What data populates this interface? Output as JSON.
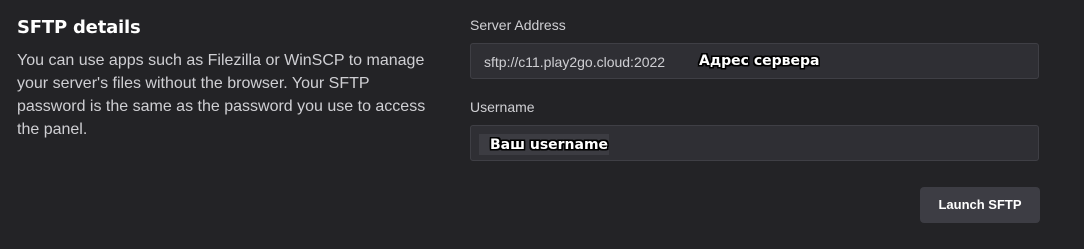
{
  "panel": {
    "title": "SFTP details",
    "description": "You can use apps such as Filezilla or WinSCP to manage your server's files without the browser. Your SFTP password is the same as the password you use to access the panel."
  },
  "server_address": {
    "label": "Server Address",
    "value": "sftp://c11.play2go.cloud:2022",
    "annotation": "Адрес сервера"
  },
  "username": {
    "label": "Username",
    "value": "",
    "annotation": "Ваш username"
  },
  "actions": {
    "launch_label": "Launch SFTP"
  },
  "colors": {
    "background": "#232326",
    "field_background": "#2f2f34",
    "button_background": "#3d3d44",
    "text_muted": "#cfcfd3"
  }
}
